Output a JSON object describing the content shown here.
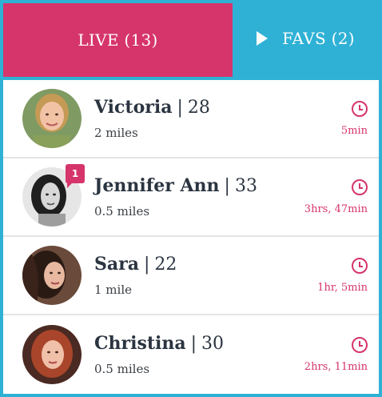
{
  "tabs": {
    "live_label": "LIVE (13)",
    "favs_label": "FAVS (2)"
  },
  "colors": {
    "live_tab": "#d6356b",
    "favs_tab": "#2fb1d6",
    "accent": "#d6356b",
    "text": "#2b3440"
  },
  "users": [
    {
      "name": "Victoria",
      "age": "28",
      "distance": "2 miles",
      "time": "5min",
      "badge": ""
    },
    {
      "name": "Jennifer Ann",
      "age": "33",
      "distance": "0.5 miles",
      "time": "3hrs, 47min",
      "badge": "1"
    },
    {
      "name": "Sara",
      "age": "22",
      "distance": "1 mile",
      "time": "1hr, 5min",
      "badge": ""
    },
    {
      "name": "Christina",
      "age": "30",
      "distance": "0.5 miles",
      "time": "2hrs, 11min",
      "badge": ""
    }
  ],
  "icons": {
    "favs": "play-icon",
    "time": "clock-icon"
  }
}
